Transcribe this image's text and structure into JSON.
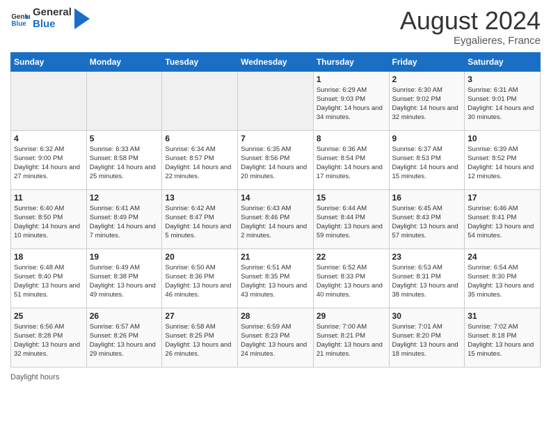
{
  "header": {
    "logo_line1": "General",
    "logo_line2": "Blue",
    "month_year": "August 2024",
    "location": "Eygalieres, France"
  },
  "days_of_week": [
    "Sunday",
    "Monday",
    "Tuesday",
    "Wednesday",
    "Thursday",
    "Friday",
    "Saturday"
  ],
  "weeks": [
    [
      {
        "day": "",
        "sunrise": "",
        "sunset": "",
        "daylight": ""
      },
      {
        "day": "",
        "sunrise": "",
        "sunset": "",
        "daylight": ""
      },
      {
        "day": "",
        "sunrise": "",
        "sunset": "",
        "daylight": ""
      },
      {
        "day": "",
        "sunrise": "",
        "sunset": "",
        "daylight": ""
      },
      {
        "day": "1",
        "sunrise": "Sunrise: 6:29 AM",
        "sunset": "Sunset: 9:03 PM",
        "daylight": "Daylight: 14 hours and 34 minutes."
      },
      {
        "day": "2",
        "sunrise": "Sunrise: 6:30 AM",
        "sunset": "Sunset: 9:02 PM",
        "daylight": "Daylight: 14 hours and 32 minutes."
      },
      {
        "day": "3",
        "sunrise": "Sunrise: 6:31 AM",
        "sunset": "Sunset: 9:01 PM",
        "daylight": "Daylight: 14 hours and 30 minutes."
      }
    ],
    [
      {
        "day": "4",
        "sunrise": "Sunrise: 6:32 AM",
        "sunset": "Sunset: 9:00 PM",
        "daylight": "Daylight: 14 hours and 27 minutes."
      },
      {
        "day": "5",
        "sunrise": "Sunrise: 6:33 AM",
        "sunset": "Sunset: 8:58 PM",
        "daylight": "Daylight: 14 hours and 25 minutes."
      },
      {
        "day": "6",
        "sunrise": "Sunrise: 6:34 AM",
        "sunset": "Sunset: 8:57 PM",
        "daylight": "Daylight: 14 hours and 22 minutes."
      },
      {
        "day": "7",
        "sunrise": "Sunrise: 6:35 AM",
        "sunset": "Sunset: 8:56 PM",
        "daylight": "Daylight: 14 hours and 20 minutes."
      },
      {
        "day": "8",
        "sunrise": "Sunrise: 6:36 AM",
        "sunset": "Sunset: 8:54 PM",
        "daylight": "Daylight: 14 hours and 17 minutes."
      },
      {
        "day": "9",
        "sunrise": "Sunrise: 6:37 AM",
        "sunset": "Sunset: 8:53 PM",
        "daylight": "Daylight: 14 hours and 15 minutes."
      },
      {
        "day": "10",
        "sunrise": "Sunrise: 6:39 AM",
        "sunset": "Sunset: 8:52 PM",
        "daylight": "Daylight: 14 hours and 12 minutes."
      }
    ],
    [
      {
        "day": "11",
        "sunrise": "Sunrise: 6:40 AM",
        "sunset": "Sunset: 8:50 PM",
        "daylight": "Daylight: 14 hours and 10 minutes."
      },
      {
        "day": "12",
        "sunrise": "Sunrise: 6:41 AM",
        "sunset": "Sunset: 8:49 PM",
        "daylight": "Daylight: 14 hours and 7 minutes."
      },
      {
        "day": "13",
        "sunrise": "Sunrise: 6:42 AM",
        "sunset": "Sunset: 8:47 PM",
        "daylight": "Daylight: 14 hours and 5 minutes."
      },
      {
        "day": "14",
        "sunrise": "Sunrise: 6:43 AM",
        "sunset": "Sunset: 8:46 PM",
        "daylight": "Daylight: 14 hours and 2 minutes."
      },
      {
        "day": "15",
        "sunrise": "Sunrise: 6:44 AM",
        "sunset": "Sunset: 8:44 PM",
        "daylight": "Daylight: 13 hours and 59 minutes."
      },
      {
        "day": "16",
        "sunrise": "Sunrise: 6:45 AM",
        "sunset": "Sunset: 8:43 PM",
        "daylight": "Daylight: 13 hours and 57 minutes."
      },
      {
        "day": "17",
        "sunrise": "Sunrise: 6:46 AM",
        "sunset": "Sunset: 8:41 PM",
        "daylight": "Daylight: 13 hours and 54 minutes."
      }
    ],
    [
      {
        "day": "18",
        "sunrise": "Sunrise: 6:48 AM",
        "sunset": "Sunset: 8:40 PM",
        "daylight": "Daylight: 13 hours and 51 minutes."
      },
      {
        "day": "19",
        "sunrise": "Sunrise: 6:49 AM",
        "sunset": "Sunset: 8:38 PM",
        "daylight": "Daylight: 13 hours and 49 minutes."
      },
      {
        "day": "20",
        "sunrise": "Sunrise: 6:50 AM",
        "sunset": "Sunset: 8:36 PM",
        "daylight": "Daylight: 13 hours and 46 minutes."
      },
      {
        "day": "21",
        "sunrise": "Sunrise: 6:51 AM",
        "sunset": "Sunset: 8:35 PM",
        "daylight": "Daylight: 13 hours and 43 minutes."
      },
      {
        "day": "22",
        "sunrise": "Sunrise: 6:52 AM",
        "sunset": "Sunset: 8:33 PM",
        "daylight": "Daylight: 13 hours and 40 minutes."
      },
      {
        "day": "23",
        "sunrise": "Sunrise: 6:53 AM",
        "sunset": "Sunset: 8:31 PM",
        "daylight": "Daylight: 13 hours and 38 minutes."
      },
      {
        "day": "24",
        "sunrise": "Sunrise: 6:54 AM",
        "sunset": "Sunset: 8:30 PM",
        "daylight": "Daylight: 13 hours and 35 minutes."
      }
    ],
    [
      {
        "day": "25",
        "sunrise": "Sunrise: 6:56 AM",
        "sunset": "Sunset: 8:28 PM",
        "daylight": "Daylight: 13 hours and 32 minutes."
      },
      {
        "day": "26",
        "sunrise": "Sunrise: 6:57 AM",
        "sunset": "Sunset: 8:26 PM",
        "daylight": "Daylight: 13 hours and 29 minutes."
      },
      {
        "day": "27",
        "sunrise": "Sunrise: 6:58 AM",
        "sunset": "Sunset: 8:25 PM",
        "daylight": "Daylight: 13 hours and 26 minutes."
      },
      {
        "day": "28",
        "sunrise": "Sunrise: 6:59 AM",
        "sunset": "Sunset: 8:23 PM",
        "daylight": "Daylight: 13 hours and 24 minutes."
      },
      {
        "day": "29",
        "sunrise": "Sunrise: 7:00 AM",
        "sunset": "Sunset: 8:21 PM",
        "daylight": "Daylight: 13 hours and 21 minutes."
      },
      {
        "day": "30",
        "sunrise": "Sunrise: 7:01 AM",
        "sunset": "Sunset: 8:20 PM",
        "daylight": "Daylight: 13 hours and 18 minutes."
      },
      {
        "day": "31",
        "sunrise": "Sunrise: 7:02 AM",
        "sunset": "Sunset: 8:18 PM",
        "daylight": "Daylight: 13 hours and 15 minutes."
      }
    ]
  ],
  "footer": {
    "daylight_label": "Daylight hours"
  }
}
